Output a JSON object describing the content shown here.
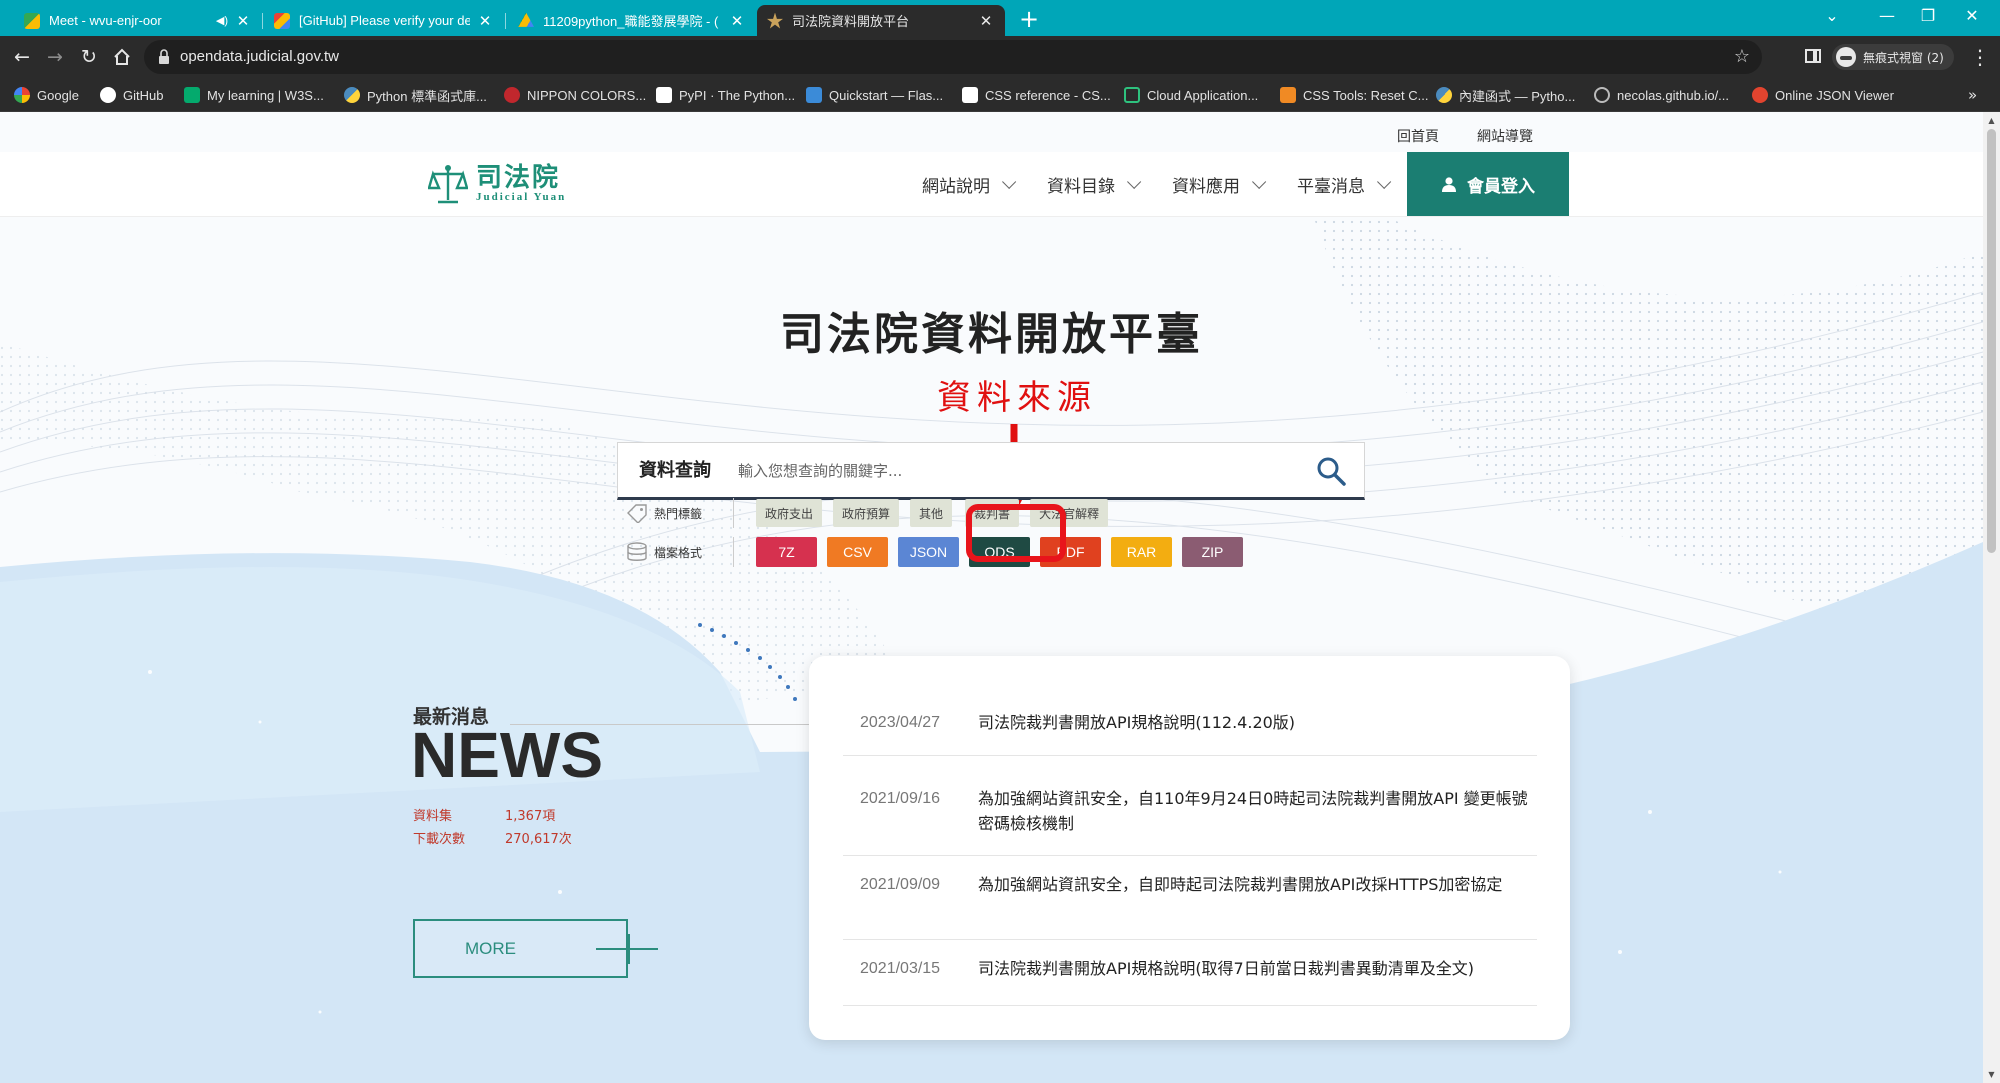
{
  "browser": {
    "tabs": [
      {
        "title": "Meet - wvu-enjr-oor",
        "favicon_color": "#34a853",
        "audio": true
      },
      {
        "title": "[GitHub] Please verify your de",
        "favicon_color": "#ea4335"
      },
      {
        "title": "11209python_職能發展學院 - (",
        "favicon_color": "#fbbc04"
      },
      {
        "title": "司法院資料開放平台",
        "favicon_color": "#c9a25b",
        "active": true
      }
    ],
    "new_tab": "+",
    "window_controls": [
      "⌄",
      "—",
      "❐",
      "✕"
    ],
    "url": "opendata.judicial.gov.tw",
    "incognito_label": "無痕式視窗 (2)",
    "bookmarks": [
      {
        "label": "Google",
        "color": "#ffffff"
      },
      {
        "label": "GitHub",
        "color": "#ffffff"
      },
      {
        "label": "My learning | W3S...",
        "color": "#04aa6d"
      },
      {
        "label": "Python 標準函式庫...",
        "color": "#4b8bbe"
      },
      {
        "label": "NIPPON COLORS...",
        "color": "#c1272d"
      },
      {
        "label": "PyPI · The Python...",
        "color": "#ffffff"
      },
      {
        "label": "Quickstart — Flas...",
        "color": "#3b8bd8"
      },
      {
        "label": "CSS reference - CS...",
        "color": "#ffffff"
      },
      {
        "label": "Cloud Application...",
        "color": "#2ec27e"
      },
      {
        "label": "CSS Tools: Reset C...",
        "color": "#f08a24"
      },
      {
        "label": "內建函式 — Pytho...",
        "color": "#4b8bbe"
      },
      {
        "label": "necolas.github.io/...",
        "color": "#bbbbbb"
      },
      {
        "label": "Online JSON Viewer",
        "color": "#e2442f"
      }
    ],
    "bookmarks_more": "»"
  },
  "site": {
    "utility_links": [
      "回首頁",
      "網站導覽"
    ],
    "logo": {
      "zh": "司法院",
      "en": "Judicial Yuan"
    },
    "nav": [
      "網站說明",
      "資料目錄",
      "資料應用",
      "平臺消息"
    ],
    "login_label": "會員登入",
    "hero_title": "司法院資料開放平臺",
    "search": {
      "label": "資料查詢",
      "placeholder": "輸入您想查詢的關鍵字..."
    },
    "hot_tags": {
      "label": "熱門標籤",
      "items": [
        "政府支出",
        "政府預算",
        "其他",
        "裁判書",
        "大法官解釋"
      ]
    },
    "formats": {
      "label": "檔案格式",
      "items": [
        {
          "label": "7Z",
          "color": "#d6314f"
        },
        {
          "label": "CSV",
          "color": "#f07a23"
        },
        {
          "label": "JSON",
          "color": "#5b86d4"
        },
        {
          "label": "ODS",
          "color": "#1f4a43"
        },
        {
          "label": "PDF",
          "color": "#e0411f"
        },
        {
          "label": "RAR",
          "color": "#f3ad11"
        },
        {
          "label": "ZIP",
          "color": "#8b5c72"
        }
      ]
    },
    "news": {
      "subtitle": "最新消息",
      "title": "NEWS",
      "stats": [
        {
          "label": "資料集",
          "value": "1,367項"
        },
        {
          "label": "下載次數",
          "value": "270,617次"
        }
      ],
      "more_label": "MORE",
      "items": [
        {
          "date": "2023/04/27",
          "text": "司法院裁判書開放API規格說明(112.4.20版)"
        },
        {
          "date": "2021/09/16",
          "text": "為加強網站資訊安全，自110年9月24日0時起司法院裁判書開放API 變更帳號密碼檢核機制"
        },
        {
          "date": "2021/09/09",
          "text": "為加強網站資訊安全，自即時起司法院裁判書開放API改採HTTPS加密協定"
        },
        {
          "date": "2021/03/15",
          "text": "司法院裁判書開放API規格說明(取得7日前當日裁判書異動清單及全文)"
        }
      ]
    }
  },
  "annotation": {
    "text": "資料來源",
    "color": "#e01010"
  },
  "colors": {
    "tabstrip": "#00a6b8",
    "brand_green": "#1b7e72",
    "annotation_red": "#e8141b"
  }
}
